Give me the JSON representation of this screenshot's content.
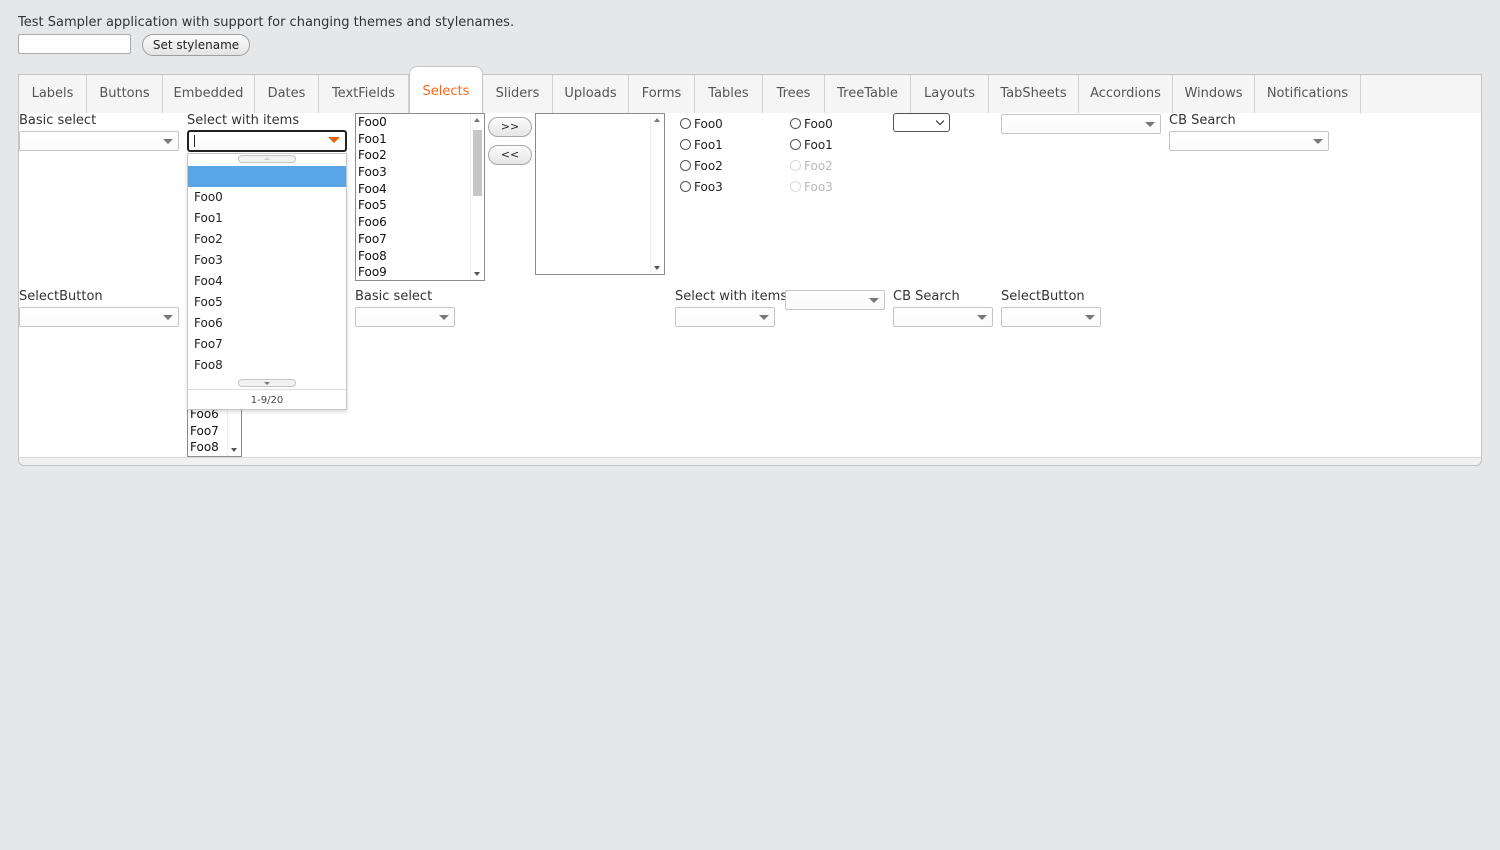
{
  "header": {
    "title": "Test Sampler application with support for changing themes and stylenames.",
    "stylename_value": "",
    "set_stylename_label": "Set stylename"
  },
  "tabs": [
    {
      "label": "Labels",
      "selected": false
    },
    {
      "label": "Buttons",
      "selected": false
    },
    {
      "label": "Embedded",
      "selected": false
    },
    {
      "label": "Dates",
      "selected": false
    },
    {
      "label": "TextFields",
      "selected": false
    },
    {
      "label": "Selects",
      "selected": true
    },
    {
      "label": "Sliders",
      "selected": false
    },
    {
      "label": "Uploads",
      "selected": false
    },
    {
      "label": "Forms",
      "selected": false
    },
    {
      "label": "Tables",
      "selected": false
    },
    {
      "label": "Trees",
      "selected": false
    },
    {
      "label": "TreeTable",
      "selected": false
    },
    {
      "label": "Layouts",
      "selected": false
    },
    {
      "label": "TabSheets",
      "selected": false
    },
    {
      "label": "Accordions",
      "selected": false
    },
    {
      "label": "Windows",
      "selected": false
    },
    {
      "label": "Notifications",
      "selected": false
    }
  ],
  "selects": {
    "row1": {
      "basic_select": {
        "caption": "Basic select",
        "value": ""
      },
      "select_with_items": {
        "caption": "Select with items",
        "value": ""
      },
      "list_select": {
        "options": [
          "Foo0",
          "Foo1",
          "Foo2",
          "Foo3",
          "Foo4",
          "Foo5",
          "Foo6",
          "Foo7",
          "Foo8",
          "Foo9"
        ]
      },
      "twin_select": {
        "add_label": ">>",
        "remove_label": "<<",
        "right_options": []
      },
      "option_group": {
        "options": [
          "Foo0",
          "Foo1",
          "Foo2",
          "Foo3"
        ]
      },
      "option_group_disabled": {
        "options": [
          "Foo0",
          "Foo1",
          "Foo2",
          "Foo3"
        ],
        "disabled_from": 2
      },
      "native_select": {
        "value": ""
      },
      "combo_no_caption": {
        "value": ""
      },
      "cb_search": {
        "caption": "CB Search",
        "value": ""
      }
    },
    "row2": {
      "select_button": {
        "caption": "SelectButton",
        "value": ""
      },
      "list_select_small": {
        "visible_options": [
          "Foo6",
          "Foo7",
          "Foo8"
        ]
      },
      "basic_select": {
        "caption": "Basic select",
        "value": ""
      },
      "select_with_items": {
        "caption": "Select with items",
        "value": ""
      },
      "combo_no_caption": {
        "value": ""
      },
      "cb_search": {
        "caption": "CB Search",
        "value": ""
      },
      "select_button_2": {
        "caption": "SelectButton",
        "value": ""
      }
    }
  },
  "popup": {
    "items": [
      "",
      "Foo0",
      "Foo1",
      "Foo2",
      "Foo3",
      "Foo4",
      "Foo5",
      "Foo6",
      "Foo7",
      "Foo8"
    ],
    "highlighted_index": 0,
    "status": "1-9/20"
  },
  "colors": {
    "accent": "#ee6a1f",
    "highlight": "#5aa5e6",
    "background": "#e6e7e9"
  }
}
